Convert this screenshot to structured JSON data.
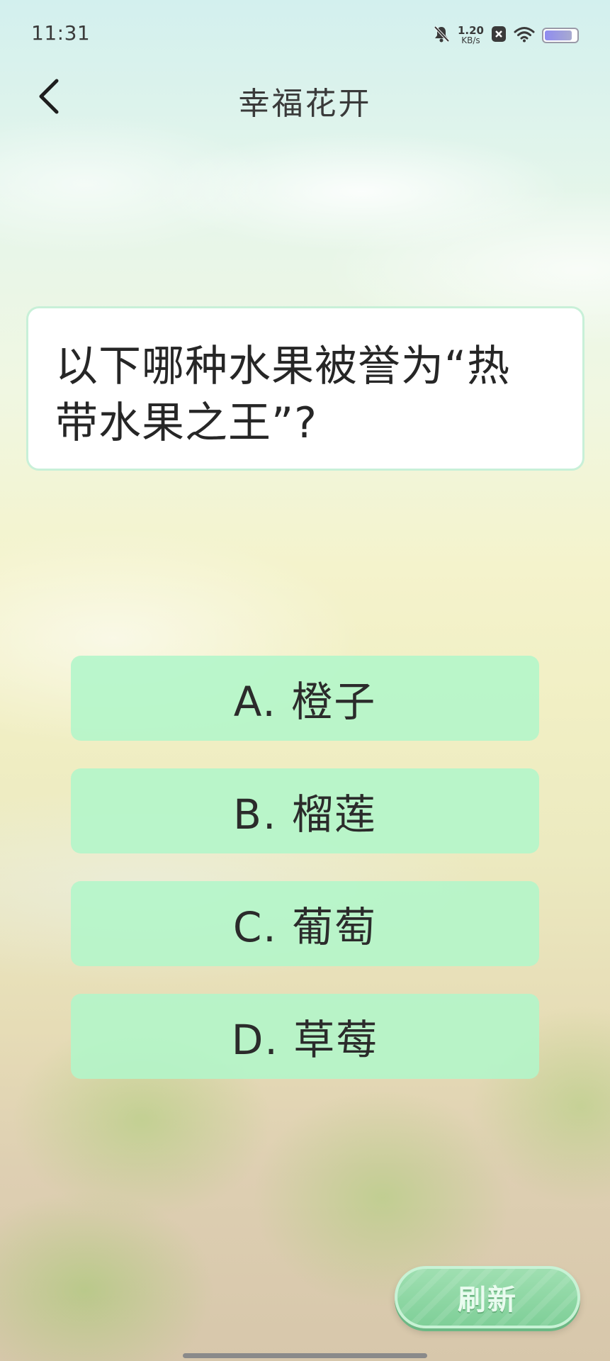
{
  "status_bar": {
    "time": "11:31",
    "net_speed_value": "1.20",
    "net_speed_unit": "KB/s",
    "icons": [
      "mute-bell-icon",
      "notification-x-icon",
      "wifi-icon",
      "battery-icon"
    ],
    "battery_level": 0.87
  },
  "header": {
    "title": "幸福花开",
    "back_icon": "chevron-left-icon"
  },
  "question": {
    "line1": "以下哪种水果被誉为“热",
    "line2": "带水果之王”?"
  },
  "options": [
    {
      "label": "A. 橙子"
    },
    {
      "label": "B. 榴莲"
    },
    {
      "label": "C. 葡萄"
    },
    {
      "label": "D. 草莓"
    }
  ],
  "refresh_button": {
    "label": "刷新"
  },
  "colors": {
    "option_bg": "#b2f6ca",
    "card_border": "#c8f0d8",
    "refresh_bg": "#8fd7a5",
    "text_dark": "#262626"
  }
}
